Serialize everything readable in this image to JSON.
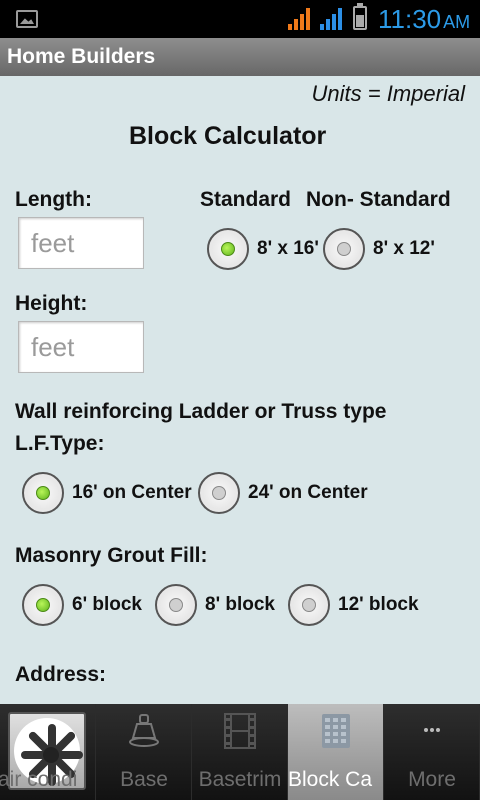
{
  "status_bar": {
    "time": "11:30",
    "ampm": "AM",
    "icons": [
      "picture-icon",
      "signal-orange-icon",
      "signal-blue-icon",
      "battery-icon"
    ],
    "colors": {
      "clock": "#2c9be8",
      "signal_orange": "#f07a1a",
      "signal_blue": "#2c8fe6"
    }
  },
  "title_bar": {
    "title": "Home Builders"
  },
  "main": {
    "units": "Units = Imperial",
    "calculator_title": "Block Calculator",
    "length": {
      "label": "Length:",
      "placeholder": "feet",
      "value": ""
    },
    "height": {
      "label": "Height:",
      "placeholder": "feet",
      "value": ""
    },
    "block_size": {
      "header_standard": "Standard",
      "header_non_standard": "Non- Standard",
      "options": [
        {
          "label": "8' x 16'",
          "selected": true
        },
        {
          "label": "8' x 12'",
          "selected": false
        }
      ]
    },
    "reinforcing": {
      "label_line1": "Wall reinforcing Ladder or Truss type",
      "label_line2": "L.F.Type:",
      "options": [
        {
          "label": "16' on Center",
          "selected": true
        },
        {
          "label": "24' on Center",
          "selected": false
        }
      ]
    },
    "grout": {
      "label": "Masonry Grout Fill:",
      "options": [
        {
          "label": "6' block",
          "selected": true
        },
        {
          "label": "8' block",
          "selected": false
        },
        {
          "label": "12' block",
          "selected": false
        }
      ]
    },
    "address": {
      "label": "Address:"
    }
  },
  "tab_bar": {
    "tabs": [
      {
        "label": "air condi",
        "icon": "fan-icon",
        "active": false
      },
      {
        "label": "Base",
        "icon": "base-icon",
        "active": false
      },
      {
        "label": "Basetrim",
        "icon": "film-icon",
        "active": false
      },
      {
        "label": "Block Ca",
        "icon": "calculator-icon",
        "active": true
      },
      {
        "label": "More",
        "icon": "more-icon",
        "active": false
      }
    ],
    "colors": {
      "active_bg": "#a8a8a8",
      "inactive_label": "#6e6e6e",
      "radio_selected": "#5fb41c"
    }
  }
}
